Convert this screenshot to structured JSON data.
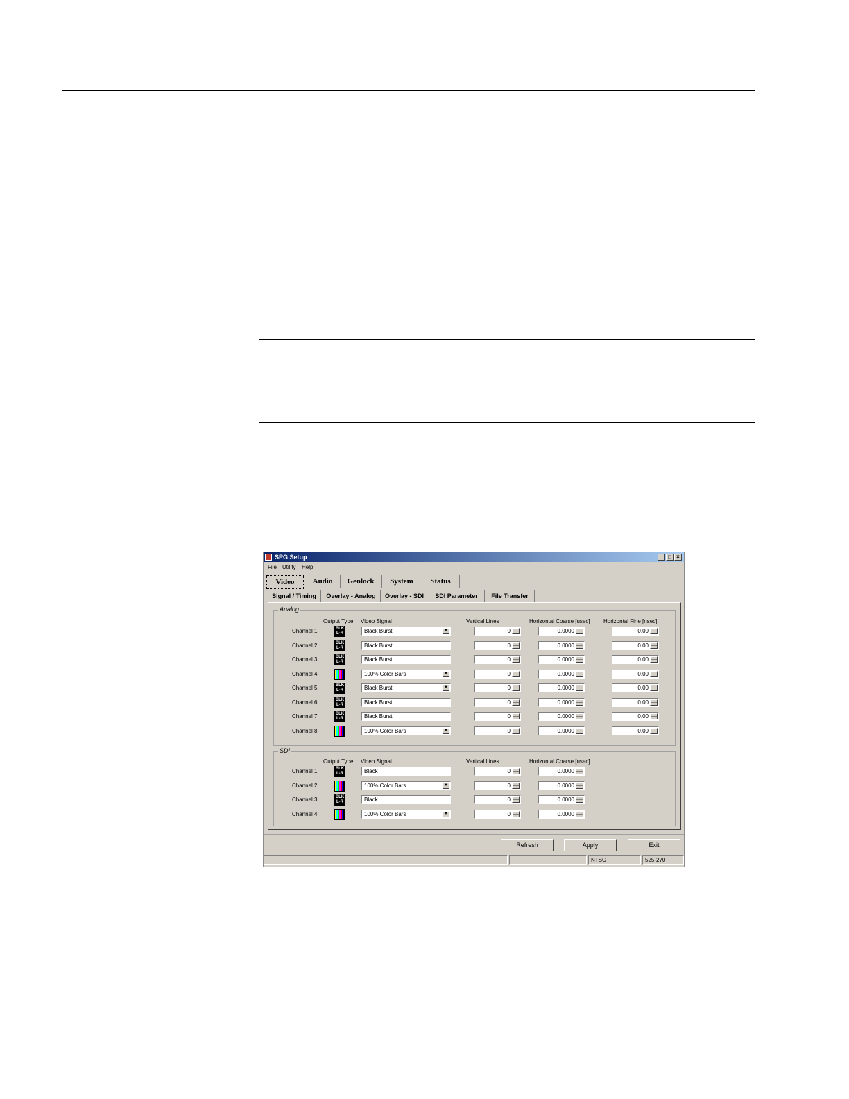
{
  "window": {
    "title": "SPG Setup",
    "controls": [
      "_",
      "□",
      "×"
    ]
  },
  "menu": [
    "File",
    "Utility",
    "Help"
  ],
  "main_tabs": [
    "Video",
    "Audio",
    "Genlock",
    "System",
    "Status"
  ],
  "sub_tabs": [
    "Signal / Timing",
    "Overlay - Analog",
    "Overlay - SDI",
    "SDI Parameter",
    "File Transfer"
  ],
  "analog": {
    "label": "Analog",
    "headers": {
      "output_type": "Output Type",
      "video_signal": "Video Signal",
      "vertical_lines": "Vertical Lines",
      "horizontal_coarse": "Horizontal Coarse [usec]",
      "horizontal_fine": "Horizontal Fine [nsec]"
    },
    "rows": [
      {
        "channel": "Channel 1",
        "type": "BLK",
        "signal": "Black Burst",
        "dropdown": true,
        "vlines": "0",
        "hcoarse": "0.0000",
        "hfine": "0.00"
      },
      {
        "channel": "Channel 2",
        "type": "BLK",
        "signal": "Black Burst",
        "dropdown": false,
        "vlines": "0",
        "hcoarse": "0.0000",
        "hfine": "0.00"
      },
      {
        "channel": "Channel 3",
        "type": "BLK",
        "signal": "Black Burst",
        "dropdown": false,
        "vlines": "0",
        "hcoarse": "0.0000",
        "hfine": "0.00"
      },
      {
        "channel": "Channel 4",
        "type": "BARS",
        "signal": "100% Color Bars",
        "dropdown": true,
        "vlines": "0",
        "hcoarse": "0.0000",
        "hfine": "0.00"
      },
      {
        "channel": "Channel 5",
        "type": "BLK",
        "signal": "Black Burst",
        "dropdown": true,
        "vlines": "0",
        "hcoarse": "0.0000",
        "hfine": "0.00"
      },
      {
        "channel": "Channel 6",
        "type": "BLK",
        "signal": "Black Burst",
        "dropdown": false,
        "vlines": "0",
        "hcoarse": "0.0000",
        "hfine": "0.00"
      },
      {
        "channel": "Channel 7",
        "type": "BLK",
        "signal": "Black Burst",
        "dropdown": false,
        "vlines": "0",
        "hcoarse": "0.0000",
        "hfine": "0.00"
      },
      {
        "channel": "Channel 8",
        "type": "BARS",
        "signal": "100% Color Bars",
        "dropdown": true,
        "vlines": "0",
        "hcoarse": "0.0000",
        "hfine": "0.00"
      }
    ]
  },
  "sdi": {
    "label": "SDI",
    "headers": {
      "output_type": "Output Type",
      "video_signal": "Video Signal",
      "vertical_lines": "Vertical Lines",
      "horizontal_coarse": "Horizontal Coarse [usec]"
    },
    "rows": [
      {
        "channel": "Channel 1",
        "type": "BLK",
        "signal": "Black",
        "dropdown": false,
        "vlines": "0",
        "hcoarse": "0.0000"
      },
      {
        "channel": "Channel 2",
        "type": "BARS",
        "signal": "100% Color Bars",
        "dropdown": true,
        "vlines": "0",
        "hcoarse": "0.0000"
      },
      {
        "channel": "Channel 3",
        "type": "BLK",
        "signal": "Black",
        "dropdown": false,
        "vlines": "0",
        "hcoarse": "0.0000"
      },
      {
        "channel": "Channel 4",
        "type": "BARS",
        "signal": "100% Color Bars",
        "dropdown": true,
        "vlines": "0",
        "hcoarse": "0.0000"
      }
    ]
  },
  "blk_icon_text": [
    "BLK",
    "L-R"
  ],
  "buttons": {
    "refresh": "Refresh",
    "apply": "Apply",
    "exit": "Exit"
  },
  "status": {
    "format": "NTSC",
    "mode": "525-270"
  },
  "colors": {
    "title_start": "#0a246a",
    "title_end": "#a6caf0",
    "face": "#d4d0c8"
  }
}
